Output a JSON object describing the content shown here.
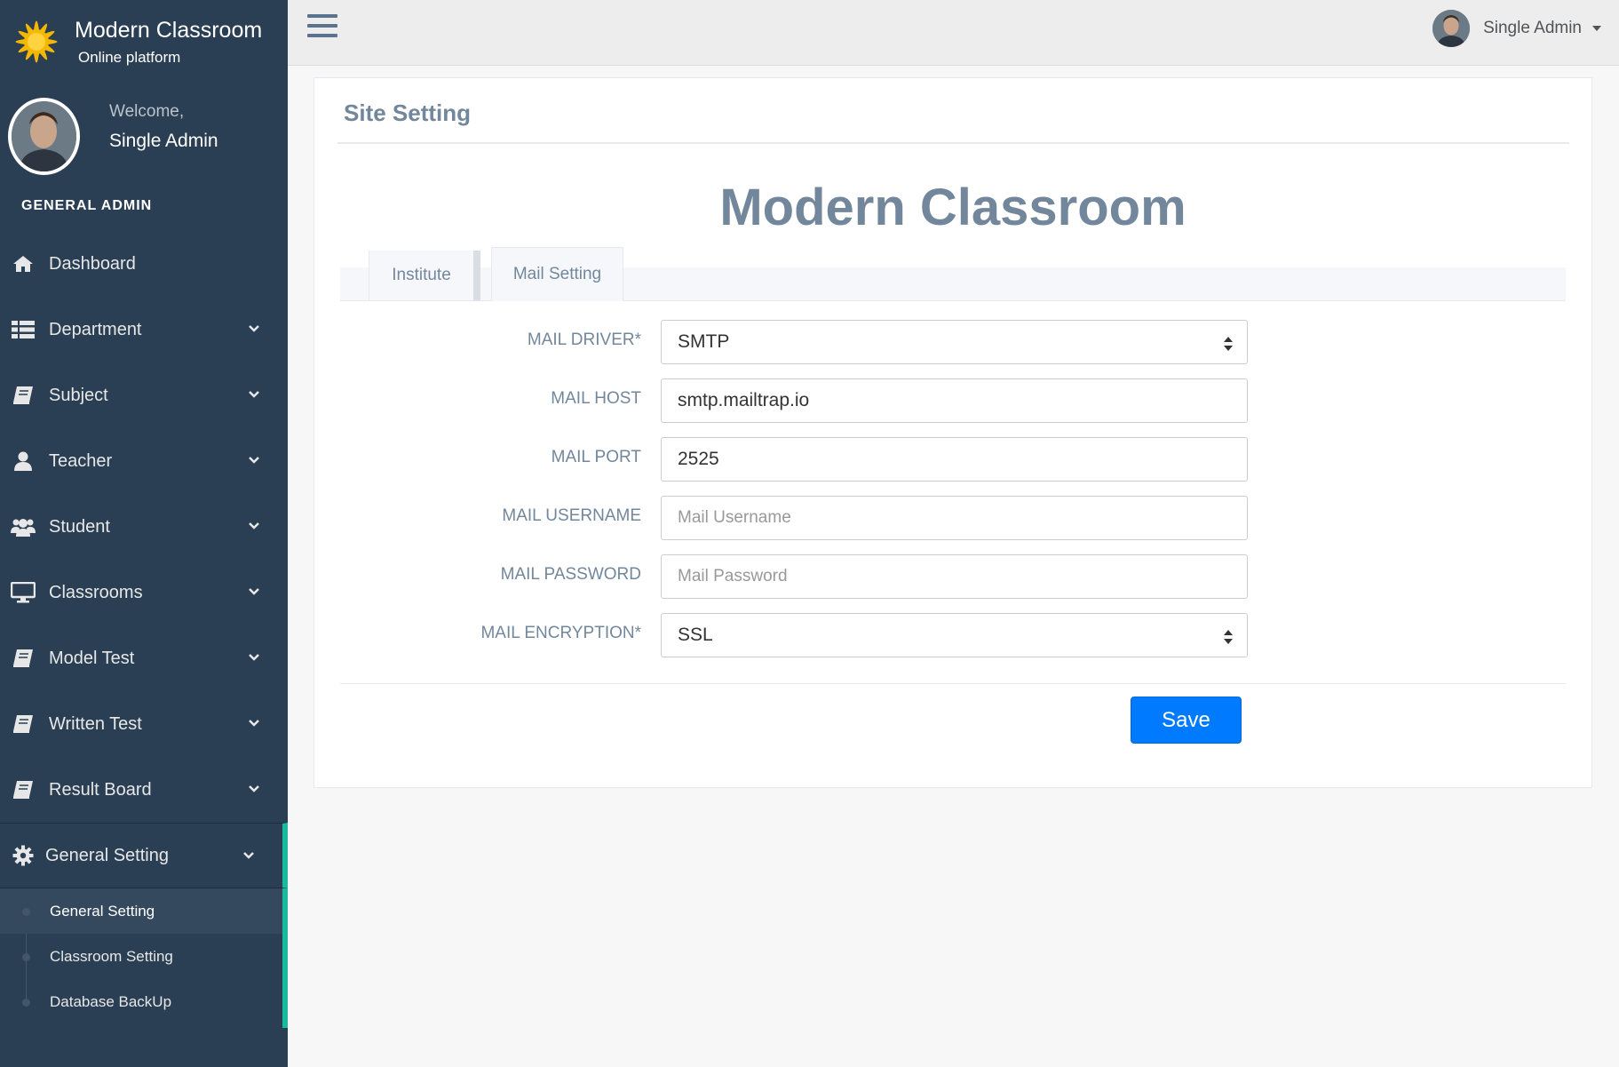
{
  "app": {
    "brand_name": "Modern Classroom",
    "brand_sub": "Online platform"
  },
  "profile": {
    "welcome": "Welcome,",
    "name": "Single Admin"
  },
  "sidebar": {
    "section_title": "GENERAL ADMIN",
    "items": [
      {
        "label": "Dashboard",
        "icon": "home-icon"
      },
      {
        "label": "Department",
        "icon": "list-icon"
      },
      {
        "label": "Subject",
        "icon": "book-icon"
      },
      {
        "label": "Teacher",
        "icon": "user-icon"
      },
      {
        "label": "Student",
        "icon": "users-icon"
      },
      {
        "label": "Classrooms",
        "icon": "desktop-icon"
      },
      {
        "label": "Model Test",
        "icon": "book-icon"
      },
      {
        "label": "Written Test",
        "icon": "book-icon"
      },
      {
        "label": "Result Board",
        "icon": "book-icon"
      },
      {
        "label": "General Setting",
        "icon": "gear-icon"
      }
    ],
    "submenu": [
      {
        "label": "General Setting"
      },
      {
        "label": "Classroom Setting"
      },
      {
        "label": "Database BackUp"
      }
    ]
  },
  "topbar": {
    "user_name": "Single Admin"
  },
  "panel": {
    "title": "Site Setting",
    "heading": "Modern Classroom",
    "tabs": [
      {
        "label": "Institute"
      },
      {
        "label": "Mail Setting"
      }
    ]
  },
  "form": {
    "mail_driver": {
      "label": "MAIL DRIVER*",
      "value": "SMTP"
    },
    "mail_host": {
      "label": "MAIL HOST",
      "value": "smtp.mailtrap.io"
    },
    "mail_port": {
      "label": "MAIL PORT",
      "value": "2525"
    },
    "mail_username": {
      "label": "MAIL USERNAME",
      "placeholder": "Mail Username"
    },
    "mail_password": {
      "label": "MAIL PASSWORD",
      "placeholder": "Mail Password"
    },
    "mail_encryption": {
      "label": "MAIL ENCRYPTION*",
      "value": "SSL"
    },
    "save_label": "Save"
  },
  "colors": {
    "sidebar_bg": "#2a3f54",
    "active_accent": "#1abb9c",
    "primary_button": "#007bff",
    "brand_sun": "#f5b800"
  }
}
